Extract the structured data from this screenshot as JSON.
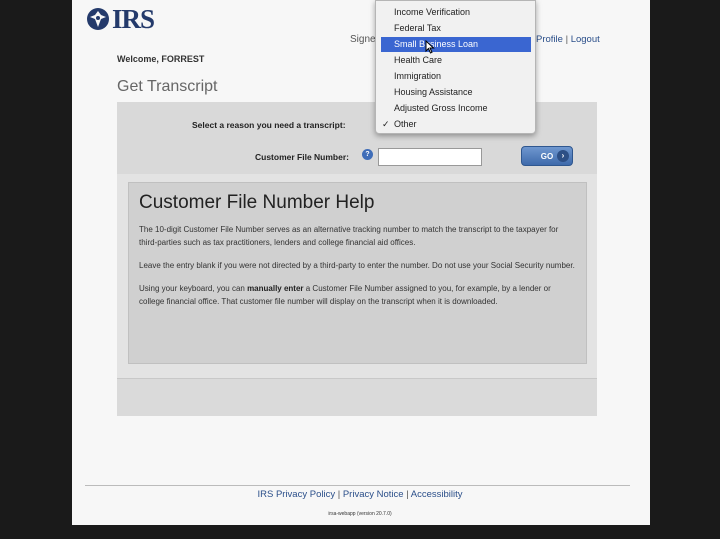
{
  "header": {
    "logo_text": "IRS",
    "signed_text": "Signe",
    "links": [
      "Profile",
      "Logout"
    ]
  },
  "welcome": "Welcome, FORREST",
  "page_title": "Get Transcript",
  "form": {
    "reason_label": "Select a reason you need a transcript:",
    "reason_selected": "Other",
    "reason_options": [
      "Income Verification",
      "Federal Tax",
      "Small Business Loan",
      "Health Care",
      "Immigration",
      "Housing Assistance",
      "Adjusted Gross Income",
      "Other"
    ],
    "highlighted_option": "Small Business Loan",
    "cfn_label": "Customer File Number:",
    "help_icon": "?",
    "cfn_value": "",
    "go_label": "GO"
  },
  "help": {
    "title": "Customer File Number Help",
    "p1": "The 10-digit Customer File Number serves as an alternative tracking number to match the transcript to the taxpayer for third-parties such as tax practitioners, lenders and college financial aid offices.",
    "p2": "Leave the entry blank if you were not directed by a third-party to enter the number. Do not use your Social Security number.",
    "p3_a": "Using your keyboard, you can ",
    "p3_b": "manually enter",
    "p3_c": " a Customer File Number assigned to you, for example, by a lender or college financial office. That customer file number will display on the transcript when it is downloaded."
  },
  "footer": {
    "links": [
      "IRS Privacy Policy",
      "Privacy Notice",
      "Accessibility"
    ],
    "version": "irsa-webapp (version 20.7.0)"
  },
  "colors": {
    "brand": "#243a6b",
    "link": "#2b4f8a",
    "highlight": "#3a66d1",
    "button": "#3e6aab"
  },
  "icons": [
    "irs-eagle-icon",
    "help-question-icon",
    "go-arrow-icon",
    "checkmark-icon",
    "mouse-pointer-icon"
  ]
}
